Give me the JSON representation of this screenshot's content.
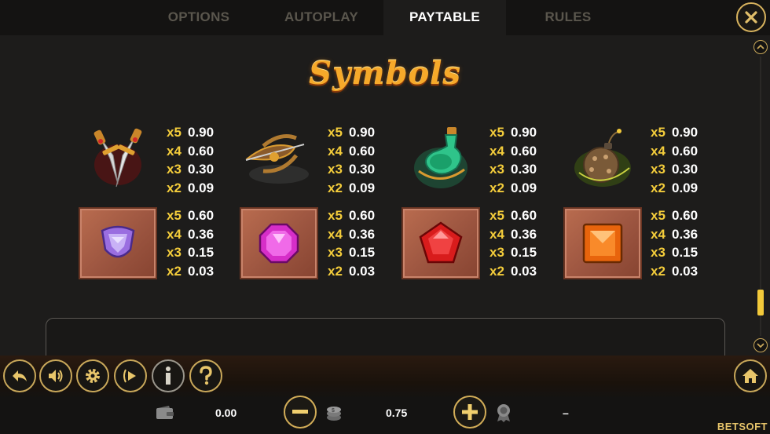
{
  "tabs": [
    {
      "label": "OPTIONS"
    },
    {
      "label": "AUTOPLAY"
    },
    {
      "label": "PAYTABLE",
      "active": true
    },
    {
      "label": "RULES"
    }
  ],
  "heading": "Symbols",
  "symbols": [
    {
      "name": "daggers",
      "pays": [
        {
          "m": "x5",
          "v": "0.90"
        },
        {
          "m": "x4",
          "v": "0.60"
        },
        {
          "m": "x3",
          "v": "0.30"
        },
        {
          "m": "x2",
          "v": "0.09"
        }
      ]
    },
    {
      "name": "crossbow",
      "pays": [
        {
          "m": "x5",
          "v": "0.90"
        },
        {
          "m": "x4",
          "v": "0.60"
        },
        {
          "m": "x3",
          "v": "0.30"
        },
        {
          "m": "x2",
          "v": "0.09"
        }
      ]
    },
    {
      "name": "potion",
      "pays": [
        {
          "m": "x5",
          "v": "0.90"
        },
        {
          "m": "x4",
          "v": "0.60"
        },
        {
          "m": "x3",
          "v": "0.30"
        },
        {
          "m": "x2",
          "v": "0.09"
        }
      ]
    },
    {
      "name": "bomb",
      "pays": [
        {
          "m": "x5",
          "v": "0.90"
        },
        {
          "m": "x4",
          "v": "0.60"
        },
        {
          "m": "x3",
          "v": "0.30"
        },
        {
          "m": "x2",
          "v": "0.09"
        }
      ]
    },
    {
      "name": "purple-gem",
      "pays": [
        {
          "m": "x5",
          "v": "0.60"
        },
        {
          "m": "x4",
          "v": "0.36"
        },
        {
          "m": "x3",
          "v": "0.15"
        },
        {
          "m": "x2",
          "v": "0.03"
        }
      ]
    },
    {
      "name": "pink-gem",
      "pays": [
        {
          "m": "x5",
          "v": "0.60"
        },
        {
          "m": "x4",
          "v": "0.36"
        },
        {
          "m": "x3",
          "v": "0.15"
        },
        {
          "m": "x2",
          "v": "0.03"
        }
      ]
    },
    {
      "name": "red-gem",
      "pays": [
        {
          "m": "x5",
          "v": "0.60"
        },
        {
          "m": "x4",
          "v": "0.36"
        },
        {
          "m": "x3",
          "v": "0.15"
        },
        {
          "m": "x2",
          "v": "0.03"
        }
      ]
    },
    {
      "name": "orange-gem",
      "pays": [
        {
          "m": "x5",
          "v": "0.60"
        },
        {
          "m": "x4",
          "v": "0.36"
        },
        {
          "m": "x3",
          "v": "0.15"
        },
        {
          "m": "x2",
          "v": "0.03"
        }
      ]
    }
  ],
  "bottom_bar": {
    "balance": "0.00",
    "bet": "0.75",
    "win": "–",
    "brand": "BETSOFT"
  },
  "colors": {
    "accent_gold": "#d8b35e",
    "multiplier_yellow": "#f3cc3b",
    "heading_orange": "#f6a92a"
  }
}
